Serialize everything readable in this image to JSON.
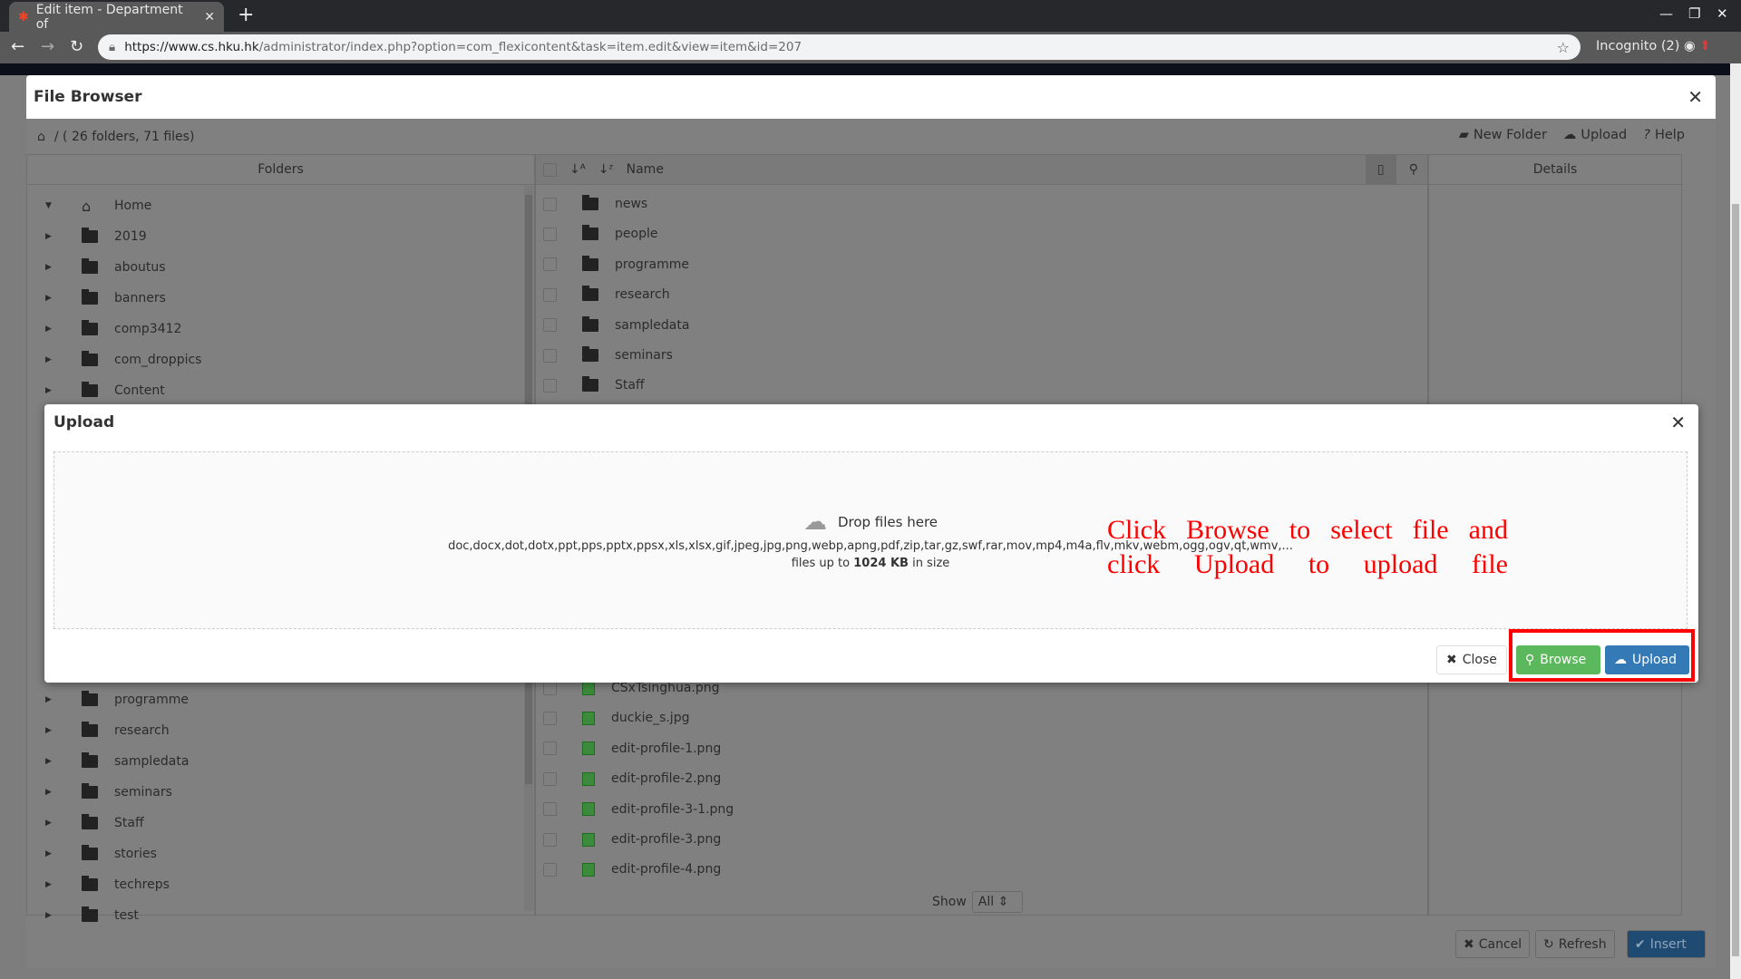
{
  "browser": {
    "tab_title": "Edit item - Department of",
    "url_host": "https://www.cs.hku.hk",
    "url_path": "/administrator/index.php?option=com_flexicontent&task=item.edit&view=item&id=207",
    "incognito": "Incognito (2)"
  },
  "file_browser": {
    "title": "File Browser",
    "breadcrumb": "/ ( 26 folders, 71 files)",
    "toolbar": {
      "new_folder": "New Folder",
      "upload": "Upload",
      "help": "Help"
    },
    "folders_header": "Folders",
    "name_header": "Name",
    "details_header": "Details",
    "folders_top": [
      "Home",
      "2019",
      "aboutus",
      "banners",
      "comp3412",
      "com_droppics",
      "Content"
    ],
    "folders_bottom": [
      "programme",
      "research",
      "sampledata",
      "seminars",
      "Staff",
      "stories",
      "techreps",
      "test"
    ],
    "files_top": [
      "news",
      "people",
      "programme",
      "research",
      "sampledata",
      "seminars",
      "Staff"
    ],
    "files_bottom": [
      "CSxTsinghua.png",
      "duckie_s.jpg",
      "edit-profile-1.png",
      "edit-profile-2.png",
      "edit-profile-3-1.png",
      "edit-profile-3.png",
      "edit-profile-4.png"
    ],
    "show_label": "Show",
    "show_value": "All",
    "buttons": {
      "cancel": "Cancel",
      "refresh": "Refresh",
      "insert": "Insert"
    }
  },
  "upload_modal": {
    "title": "Upload",
    "drop_text": "Drop files here",
    "extensions": "doc,docx,dot,dotx,ppt,pps,pptx,ppsx,xls,xlsx,gif,jpeg,jpg,png,webp,apng,pdf,zip,tar,gz,swf,rar,mov,mp4,m4a,flv,mkv,webm,ogg,ogv,qt,wmv,...",
    "size_prefix": "files up to",
    "size_value": "1024 KB",
    "size_suffix": "in size",
    "close": "Close",
    "browse": "Browse",
    "upload": "Upload"
  },
  "annotation": {
    "line1": "Click Browse to select file and",
    "line2": "click Upload to upload file",
    "color": "#ff0000"
  },
  "colors": {
    "browse": "#5cb85c",
    "upload": "#337ab7",
    "insert": "#1f4a72"
  }
}
